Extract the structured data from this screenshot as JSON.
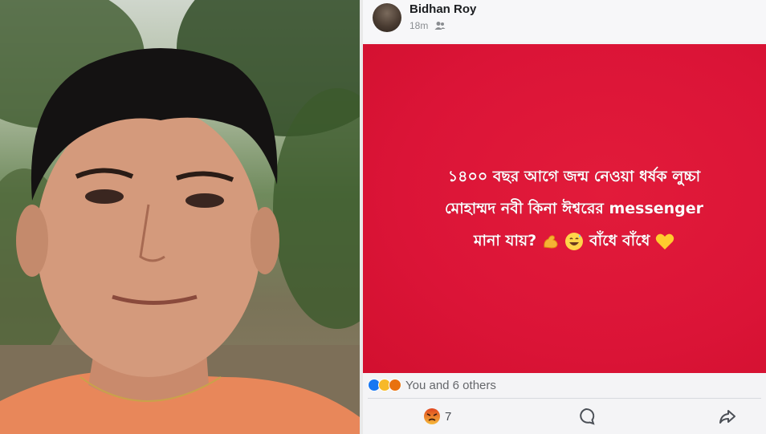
{
  "post": {
    "author": "Bidhan Roy",
    "time": "18m",
    "privacy_icon": "friends-icon",
    "text_line_1": "১৪০০ বছর আগে জন্ম নেওয়া ধর্ষক লুচ্চা",
    "text_line_2": "মোহাম্মদ নবী কিনা ঈশ্বরের messenger",
    "text_line_3a": "মানা যায়?",
    "text_line_3b": "বাঁধে বাঁধে",
    "background_color": "#db1437"
  },
  "reactions": {
    "summary": "You and 6 others",
    "icons": [
      "like-icon",
      "haha-icon",
      "angry-icon"
    ],
    "angry_count": "7"
  },
  "actions": {
    "react_icon": "angry-react-icon",
    "comment_icon": "comment-icon",
    "share_icon": "share-icon"
  }
}
